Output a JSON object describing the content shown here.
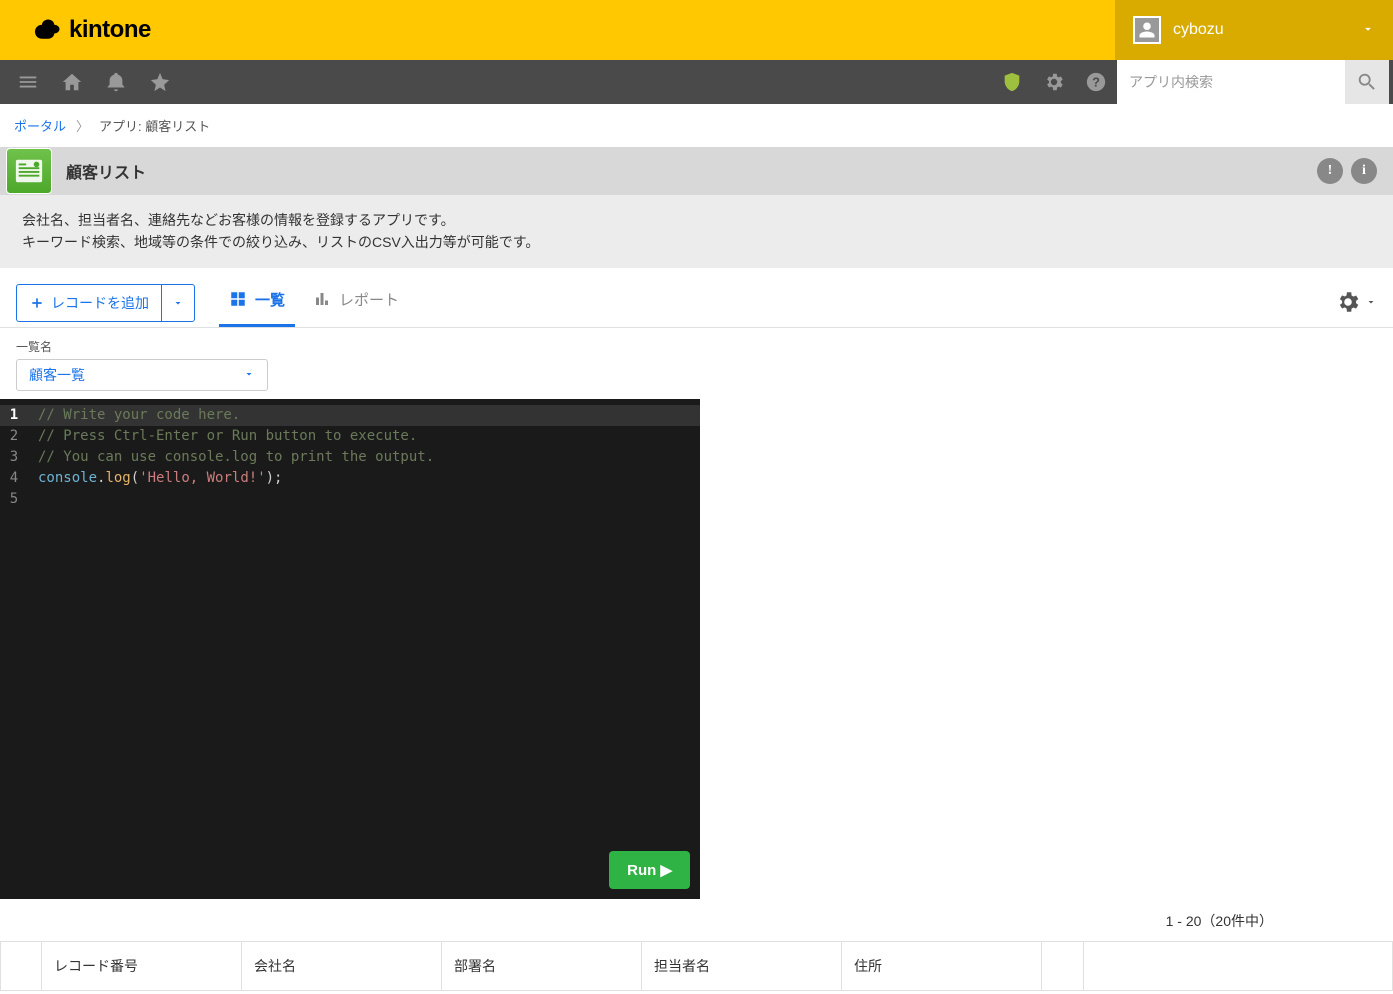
{
  "brand": "kintone",
  "user": {
    "name": "cybozu"
  },
  "search": {
    "placeholder": "アプリ内検索"
  },
  "breadcrumb": {
    "portal": "ポータル",
    "current": "アプリ: 顧客リスト"
  },
  "app": {
    "title": "顧客リスト",
    "desc_line1": "会社名、担当者名、連絡先などお客様の情報を登録するアプリです。",
    "desc_line2": "キーワード検索、地域等の条件での絞り込み、リストのCSV入出力等が可能です。"
  },
  "actions": {
    "add_record": "レコードを追加"
  },
  "tabs": {
    "list": "一覧",
    "report": "レポート"
  },
  "view": {
    "label": "一覧名",
    "selected": "顧客一覧"
  },
  "editor": {
    "lines": [
      "// Write your code here.",
      "// Press Ctrl-Enter or Run button to execute.",
      "// You can use console.log to print the output."
    ],
    "code4_obj": "console",
    "code4_fn": "log",
    "code4_str": "'Hello, World!'",
    "run_label": "Run ▶"
  },
  "pager": {
    "text": "1 - 20（20件中）"
  },
  "table": {
    "headers": [
      "レコード番号",
      "会社名",
      "部署名",
      "担当者名",
      "住所"
    ]
  }
}
